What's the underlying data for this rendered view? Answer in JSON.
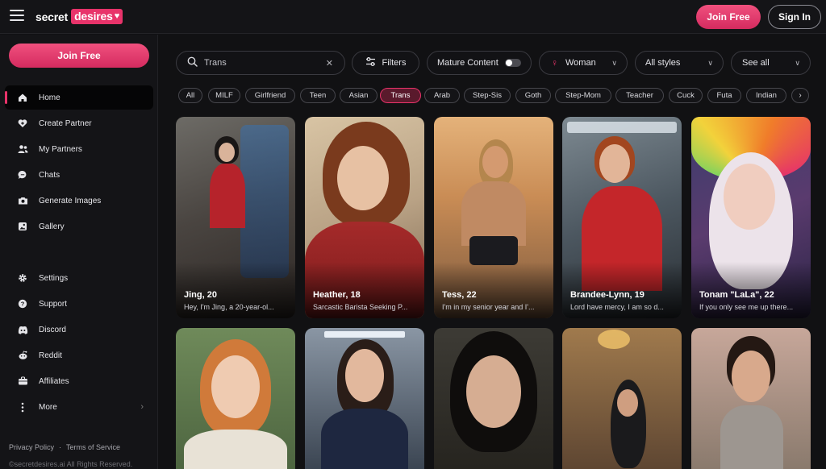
{
  "brand": {
    "word1": "secret",
    "word2": "desires",
    "heart": "♥"
  },
  "header": {
    "join_label": "Join Free",
    "signin_label": "Sign In"
  },
  "sidebar": {
    "join_label": "Join Free",
    "items": [
      {
        "label": "Home",
        "icon": "home-icon"
      },
      {
        "label": "Create Partner",
        "icon": "heart-plus-icon"
      },
      {
        "label": "My Partners",
        "icon": "users-icon"
      },
      {
        "label": "Chats",
        "icon": "chat-icon"
      },
      {
        "label": "Generate Images",
        "icon": "camera-icon"
      },
      {
        "label": "Gallery",
        "icon": "gallery-icon"
      },
      {
        "label": "Settings",
        "icon": "gear-icon"
      },
      {
        "label": "Support",
        "icon": "help-icon"
      },
      {
        "label": "Discord",
        "icon": "discord-icon"
      },
      {
        "label": "Reddit",
        "icon": "reddit-icon"
      },
      {
        "label": "Affiliates",
        "icon": "affiliates-icon"
      },
      {
        "label": "More",
        "icon": "more-vertical-icon"
      }
    ],
    "footer": {
      "privacy": "Privacy Policy",
      "separator": "·",
      "terms": "Terms of Service",
      "copyright": "©secretdesires.ai All Rights Reserved."
    }
  },
  "controls": {
    "search_value": "Trans",
    "filters_label": "Filters",
    "mature_label": "Mature Content",
    "mature_on": false,
    "gender_label": "Woman",
    "styles_label": "All styles",
    "sort_label": "See all"
  },
  "tags": [
    "All",
    "MILF",
    "Girlfriend",
    "Teen",
    "Asian",
    "Trans",
    "Arab",
    "Step-Sis",
    "Goth",
    "Step-Mom",
    "Teacher",
    "Cuck",
    "Futa",
    "Indian"
  ],
  "active_tag": "Trans",
  "cards": [
    {
      "name": "Jing, 20",
      "desc": "Hey, I'm Jing, a 20-year-ol..."
    },
    {
      "name": "Heather, 18",
      "desc": "Sarcastic Barista Seeking P..."
    },
    {
      "name": "Tess, 22",
      "desc": "I'm in my senior year and I'..."
    },
    {
      "name": "Brandee-Lynn, 19",
      "desc": "Lord have mercy, I am so d..."
    },
    {
      "name": "Tonam \"LaLa\", 22",
      "desc": "If you only see me up there..."
    },
    {
      "name": "",
      "desc": ""
    },
    {
      "name": "",
      "desc": ""
    },
    {
      "name": "",
      "desc": ""
    },
    {
      "name": "",
      "desc": ""
    },
    {
      "name": "",
      "desc": ""
    }
  ],
  "colors": {
    "accent": "#e8336a",
    "background": "#111113",
    "sidebar": "#141417"
  }
}
